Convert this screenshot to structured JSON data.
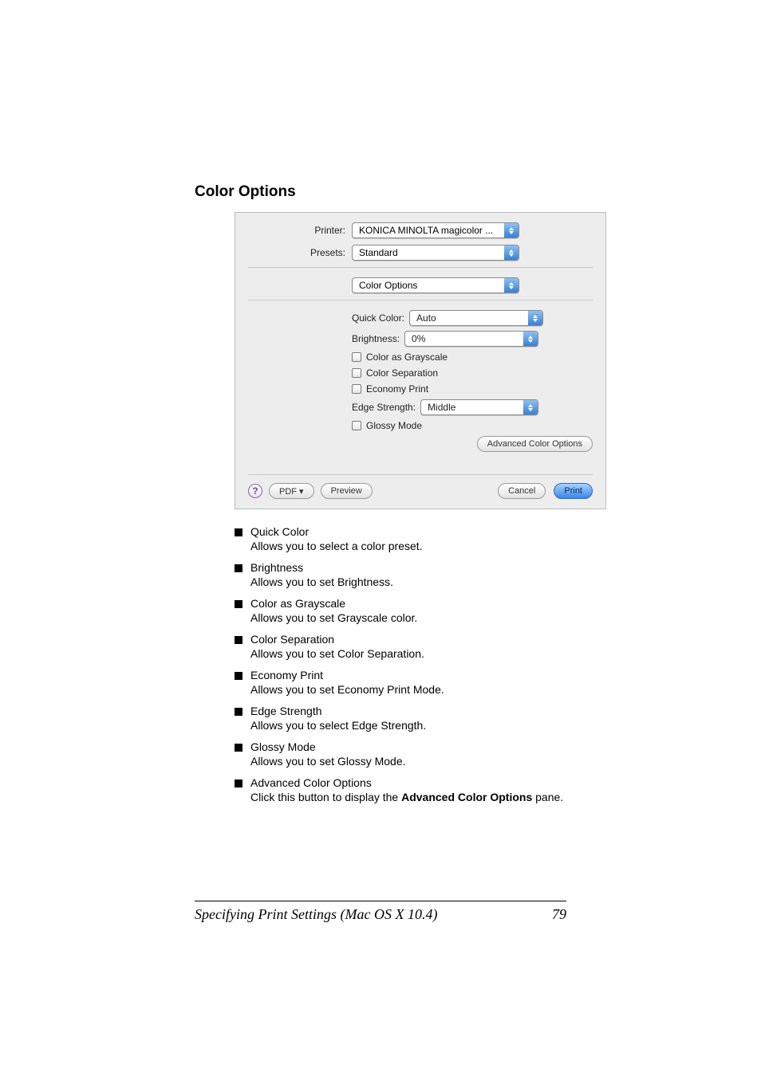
{
  "section_title": "Color Options",
  "dialog": {
    "printer": {
      "label": "Printer:",
      "value": "KONICA MINOLTA magicolor ..."
    },
    "presets": {
      "label": "Presets:",
      "value": "Standard"
    },
    "pane": {
      "value": "Color Options"
    },
    "quick_color": {
      "label": "Quick Color:",
      "value": "Auto"
    },
    "brightness": {
      "label": "Brightness:",
      "value": "0%"
    },
    "color_as_grayscale": {
      "label": "Color as Grayscale",
      "checked": false
    },
    "color_separation": {
      "label": "Color Separation",
      "checked": false
    },
    "economy_print": {
      "label": "Economy Print",
      "checked": false
    },
    "edge_strength": {
      "label": "Edge Strength:",
      "value": "Middle"
    },
    "glossy_mode": {
      "label": "Glossy Mode",
      "checked": false
    },
    "advanced_color_options": "Advanced Color Options",
    "help": "?",
    "pdf": "PDF ▾",
    "preview": "Preview",
    "cancel": "Cancel",
    "print": "Print"
  },
  "items": [
    {
      "title": "Quick Color",
      "desc": "Allows you to select a color preset."
    },
    {
      "title": "Brightness",
      "desc": "Allows you to set Brightness."
    },
    {
      "title": "Color as Grayscale",
      "desc": "Allows you to set Grayscale color."
    },
    {
      "title": "Color Separation",
      "desc": "Allows you to set Color Separation."
    },
    {
      "title": "Economy Print",
      "desc": "Allows you to set Economy Print Mode."
    },
    {
      "title": "Edge Strength",
      "desc": "Allows you to select Edge Strength."
    },
    {
      "title": "Glossy Mode",
      "desc": "Allows you to set Glossy Mode."
    },
    {
      "title": "Advanced Color Options",
      "desc_pre": "Click this button to display the ",
      "bold": "Advanced Color Options",
      "desc_post": " pane."
    }
  ],
  "footer": {
    "left": "Specifying Print Settings (Mac OS X 10.4)",
    "right": "79"
  }
}
